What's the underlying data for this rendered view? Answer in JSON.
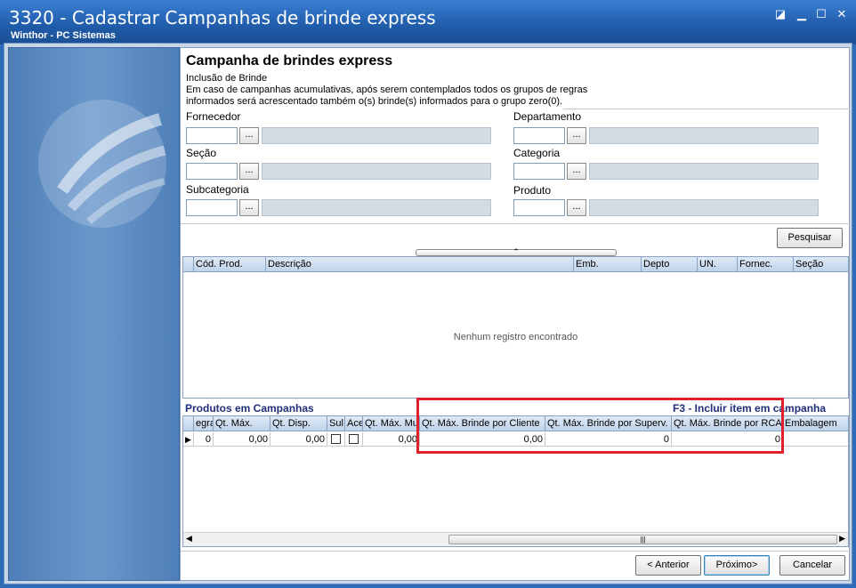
{
  "window": {
    "title": "3320 - Cadastrar Campanhas de brinde express",
    "subtitle": "Winthor - PC Sistemas"
  },
  "header": {
    "title": "Campanha de brindes express",
    "line1": "Inclusão de Brinde",
    "line2": "Em caso de campanhas acumulativas, após serem contemplados todos os grupos de regras",
    "line3": "informados será acrescentado também o(s) brinde(s) informados para o grupo zero(0)."
  },
  "filters": {
    "fornecedor": "Fornecedor",
    "departamento": "Departamento",
    "secao": "Seção",
    "categoria": "Categoria",
    "subcategoria": "Subcategoria",
    "produto": "Produto",
    "lookup_btn": "..."
  },
  "buttons": {
    "pesquisar": "Pesquisar",
    "anterior": "< Anterior",
    "proximo": "Próximo>",
    "cancelar": "Cancelar"
  },
  "search_grid": {
    "columns": [
      "Cód. Prod.",
      "Descrição",
      "Emb.",
      "Depto",
      "UN.",
      "Fornec.",
      "Seção"
    ],
    "empty_message": "Nenhum registro encontrado"
  },
  "campanhas": {
    "title": "Produtos em Campanhas",
    "shortcut": "F3 - Incluir item em campanha",
    "columns": [
      "egra",
      "Qt. Máx.",
      "Qt. Disp.",
      "Sul",
      "Ace",
      "Qt. Máx. Mu",
      "Qt. Máx. Brinde por Cliente",
      "Qt. Máx. Brinde por Superv.",
      "Qt. Máx. Brinde por RCA",
      "Embalagem"
    ],
    "row": [
      "0",
      "0,00",
      "0,00",
      "",
      "",
      "0,00",
      "0,00",
      "0",
      "0",
      ""
    ]
  },
  "colors": {
    "titlebar": "#1f5ba8",
    "highlight": "#e0202a",
    "section_title": "#1f2f7a"
  }
}
